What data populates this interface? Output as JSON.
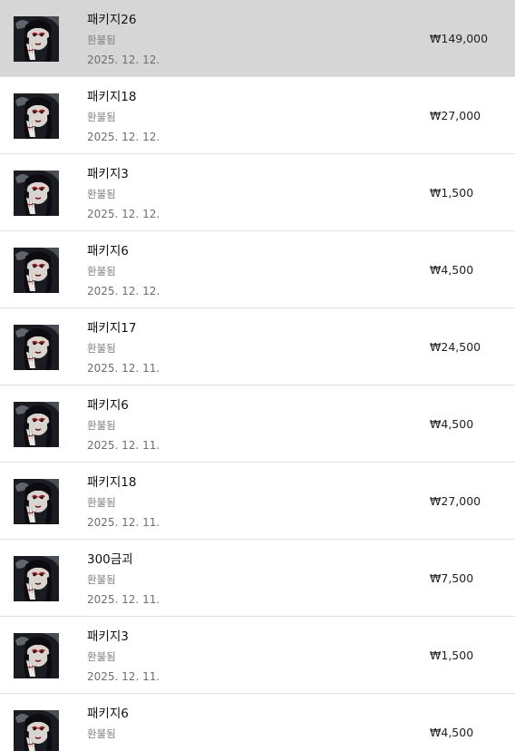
{
  "transactions": [
    {
      "title": "패키지26",
      "status": "환불됨",
      "date": "2025. 12. 12.",
      "price": "₩149,000",
      "selected": true
    },
    {
      "title": "패키지18",
      "status": "환불됨",
      "date": "2025. 12. 12.",
      "price": "₩27,000"
    },
    {
      "title": "패키지3",
      "status": "환불됨",
      "date": "2025. 12. 12.",
      "price": "₩1,500"
    },
    {
      "title": "패키지6",
      "status": "환불됨",
      "date": "2025. 12. 12.",
      "price": "₩4,500"
    },
    {
      "title": "패키지17",
      "status": "환불됨",
      "date": "2025. 12. 11.",
      "price": "₩24,500"
    },
    {
      "title": "패키지6",
      "status": "환불됨",
      "date": "2025. 12. 11.",
      "price": "₩4,500"
    },
    {
      "title": "패키지18",
      "status": "환불됨",
      "date": "2025. 12. 11.",
      "price": "₩27,000"
    },
    {
      "title": "300금괴",
      "status": "환불됨",
      "date": "2025. 12. 11.",
      "price": "₩7,500"
    },
    {
      "title": "패키지3",
      "status": "환불됨",
      "date": "2025. 12. 11.",
      "price": "₩1,500"
    },
    {
      "title": "패키지6",
      "status": "환불됨",
      "date": "",
      "price": "₩4,500"
    }
  ]
}
